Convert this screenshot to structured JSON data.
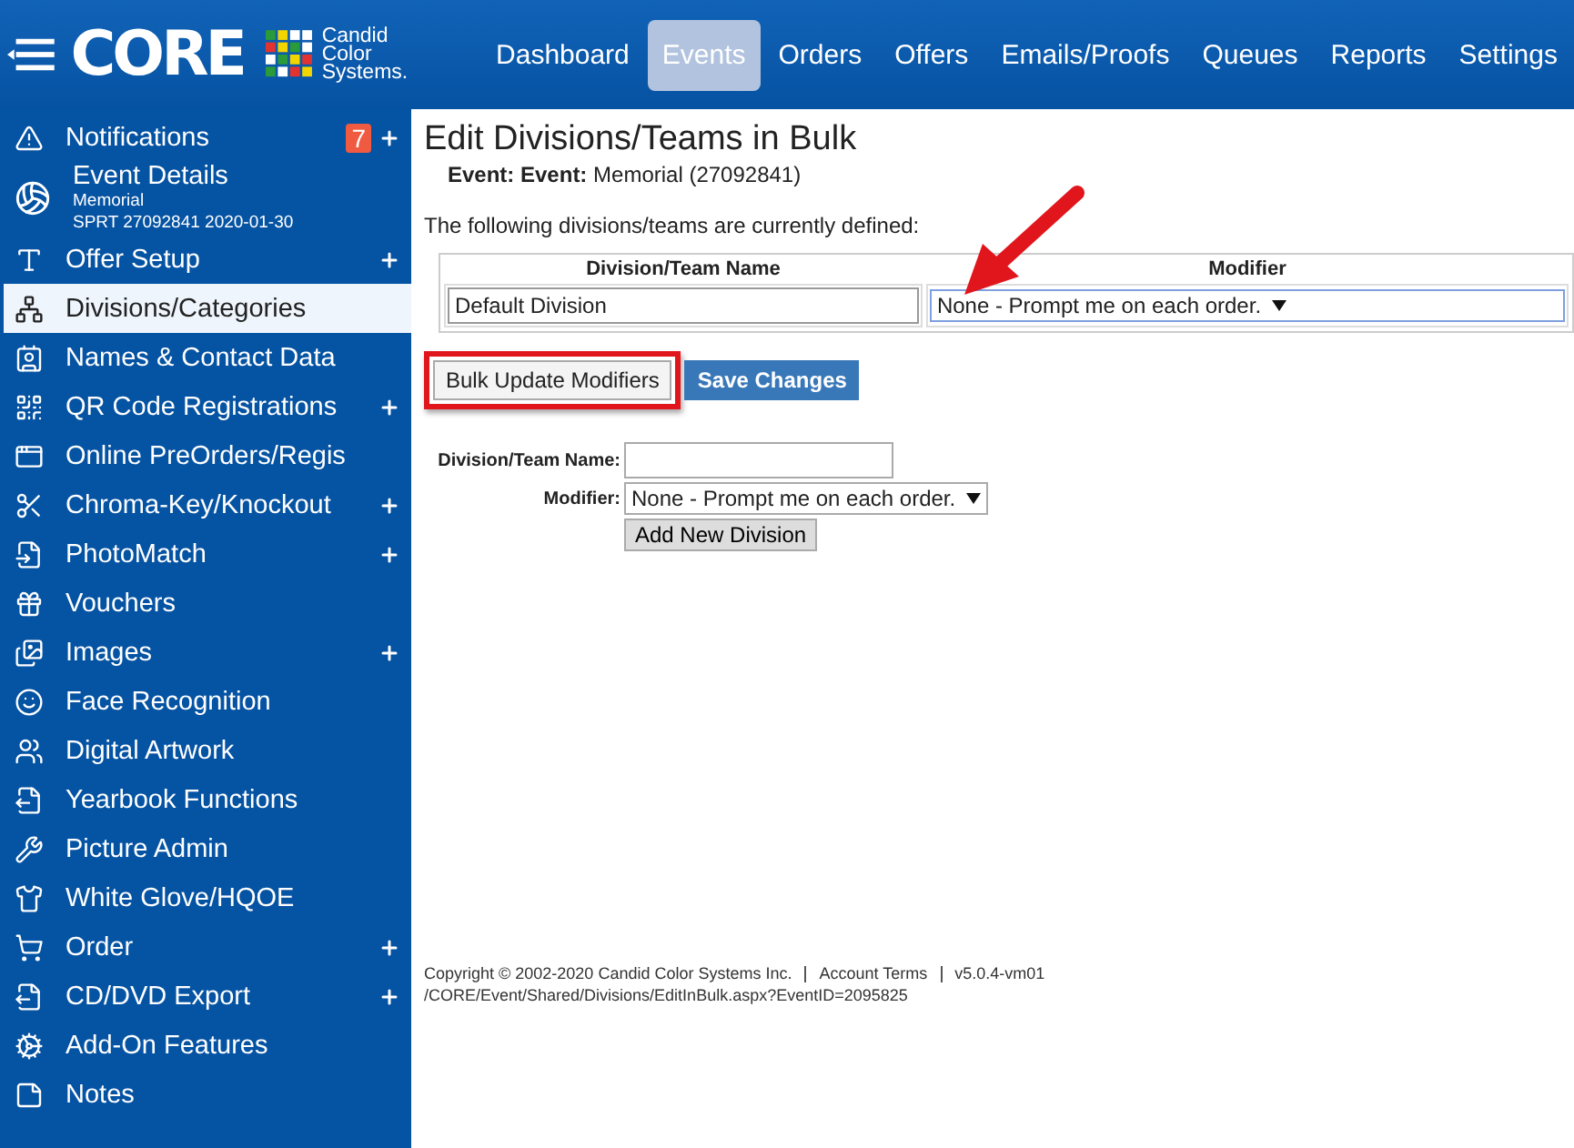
{
  "header": {
    "logo": "CORE",
    "brand_lines": [
      "Candid",
      "Color",
      "Systems."
    ],
    "nav": [
      {
        "label": "Dashboard",
        "selected": false
      },
      {
        "label": "Events",
        "selected": true
      },
      {
        "label": "Orders",
        "selected": false
      },
      {
        "label": "Offers",
        "selected": false
      },
      {
        "label": "Emails/Proofs",
        "selected": false
      },
      {
        "label": "Queues",
        "selected": false
      },
      {
        "label": "Reports",
        "selected": false
      },
      {
        "label": "Settings",
        "selected": false
      }
    ]
  },
  "sidebar": {
    "items": [
      {
        "label": "Notifications",
        "selected": false,
        "expandable": true,
        "badge": "7"
      },
      {
        "label": "Event Details",
        "selected": false,
        "expandable": false,
        "sublines": [
          "Memorial",
          "SPRT 27092841 2020-01-30"
        ]
      },
      {
        "label": "Offer Setup",
        "selected": false,
        "expandable": true
      },
      {
        "label": "Divisions/Categories",
        "selected": true,
        "expandable": false
      },
      {
        "label": "Names & Contact Data",
        "selected": false,
        "expandable": false
      },
      {
        "label": "QR Code Registrations",
        "selected": false,
        "expandable": true
      },
      {
        "label": "Online PreOrders/Regis",
        "selected": false,
        "expandable": false
      },
      {
        "label": "Chroma-Key/Knockout",
        "selected": false,
        "expandable": true
      },
      {
        "label": "PhotoMatch",
        "selected": false,
        "expandable": true
      },
      {
        "label": "Vouchers",
        "selected": false,
        "expandable": false
      },
      {
        "label": "Images",
        "selected": false,
        "expandable": true
      },
      {
        "label": "Face Recognition",
        "selected": false,
        "expandable": false
      },
      {
        "label": "Digital Artwork",
        "selected": false,
        "expandable": false
      },
      {
        "label": "Yearbook Functions",
        "selected": false,
        "expandable": false
      },
      {
        "label": "Picture Admin",
        "selected": false,
        "expandable": false
      },
      {
        "label": "White Glove/HQOE",
        "selected": false,
        "expandable": false
      },
      {
        "label": "Order",
        "selected": false,
        "expandable": true
      },
      {
        "label": "CD/DVD Export",
        "selected": false,
        "expandable": true
      },
      {
        "label": "Add-On Features",
        "selected": false,
        "expandable": false
      },
      {
        "label": "Notes",
        "selected": false,
        "expandable": false
      }
    ]
  },
  "main": {
    "title": "Edit Divisions/Teams in Bulk",
    "event_line": "**Event: Event:** Memorial (27092841)",
    "intro": "The following divisions/teams are currently defined:",
    "table": {
      "columns": [
        "Division/Team Name",
        "Modifier"
      ],
      "rows": [
        {
          "name": "Default Division",
          "modifier": "None - Prompt me on each order."
        }
      ]
    },
    "buttons": [
      {
        "label": "Bulk Update Modifiers",
        "kind": "plain",
        "highlighted": true
      },
      {
        "label": "Save Changes",
        "kind": "primary",
        "highlighted": false
      }
    ],
    "form": {
      "name_label": "Division/Team Name:",
      "modifier_label": "Modifier:",
      "modifier_value": "None - Prompt me on each order.",
      "add_button": "Add New Division"
    },
    "footer": {
      "copyright": "Copyright © 2002-2020 Candid Color Systems Inc.",
      "link": "Account Terms",
      "version": "v5.0.4-vm01",
      "path": "/CORE/Event/Shared/Divisions/EditInBulk.aspx?EventID=2095825"
    }
  }
}
